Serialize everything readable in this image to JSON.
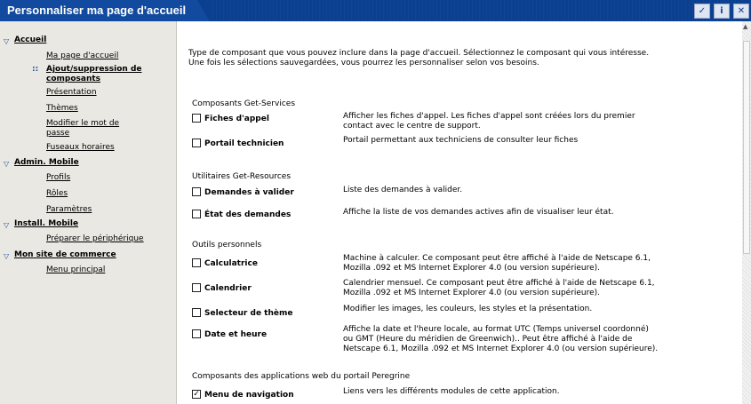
{
  "window": {
    "title": "Personnaliser ma page d'accueil",
    "icons": [
      "check-icon",
      "info-icon",
      "close-icon"
    ]
  },
  "sidebar": {
    "sections": [
      {
        "label": "Accueil",
        "items": [
          "Ma page d'accueil",
          "Ajout/suppression de composants",
          "Présentation",
          "Thèmes",
          "Modifier le mot de passe",
          "Fuseaux horaires"
        ]
      },
      {
        "label": "Admin. Mobile",
        "items": [
          "Profils",
          "Rôles",
          "Paramètres"
        ]
      },
      {
        "label": "Install. Mobile",
        "items": [
          "Préparer le périphérique"
        ]
      },
      {
        "label": "Mon site de commerce",
        "items": [
          "Menu principal"
        ]
      }
    ],
    "active_item": "Ajout/suppression de composants",
    "item_lines": {
      "add_remove_1": "Ajout/suppression de",
      "add_remove_2": "composants",
      "password_1": "Modifier le mot de",
      "password_2": "passe"
    }
  },
  "main": {
    "intro_line1": "Type de composant que vous pouvez inclure dans la page d'accueil. Sélectionnez le composant qui vous intéresse.",
    "intro_line2": "Une fois les sélections sauvegardées, vous pourrez les personnaliser selon vos besoins.",
    "groups": [
      {
        "title": "Composants Get-Services",
        "components": [
          {
            "label": "Fiches d'appel",
            "checked": false,
            "desc_lines": [
              "Afficher les fiches d'appel. Les fiches d'appel sont créées lors du premier",
              "contact avec le centre de support."
            ]
          },
          {
            "label": "Portail technicien",
            "checked": false,
            "desc_lines": [
              "Portail permettant aux techniciens de consulter leur fiches"
            ]
          }
        ]
      },
      {
        "title": "Utilitaires Get-Resources",
        "components": [
          {
            "label": "Demandes à valider",
            "checked": false,
            "desc_lines": [
              "Liste des demandes à valider."
            ]
          },
          {
            "label": "État des demandes",
            "checked": false,
            "desc_lines": [
              "Affiche la liste de vos demandes actives afin de visualiser leur état."
            ]
          }
        ]
      },
      {
        "title": "Outils personnels",
        "components": [
          {
            "label": "Calculatrice",
            "checked": false,
            "desc_lines": [
              "Machine à calculer. Ce composant peut être affiché à l'aide de Netscape 6.1,",
              "Mozilla .092 et MS Internet Explorer 4.0 (ou version supérieure)."
            ]
          },
          {
            "label": "Calendrier",
            "checked": false,
            "desc_lines": [
              "Calendrier mensuel. Ce composant peut être affiché à l'aide de Netscape 6.1,",
              "Mozilla .092 et MS Internet Explorer 4.0 (ou version supérieure)."
            ]
          },
          {
            "label": "Selecteur de thème",
            "checked": false,
            "desc_lines": [
              "Modifier les images, les couleurs, les styles et la présentation."
            ]
          },
          {
            "label": "Date et heure",
            "checked": false,
            "desc_lines": [
              "Affiche la date et l'heure locale, au format UTC (Temps universel coordonné)",
              "ou GMT (Heure du méridien de Greenwich).. Peut être affiché à l'aide de",
              "Netscape 6.1, Mozilla .092 et MS Internet Explorer 4.0 (ou version supérieure)."
            ]
          }
        ]
      },
      {
        "title": "Composants des applications web du portail Peregrine",
        "components": [
          {
            "label": "Menu de navigation",
            "checked": true,
            "desc_lines": [
              "Liens vers les différents modules de cette application."
            ]
          }
        ]
      }
    ],
    "check_mark": "✓"
  },
  "colors": {
    "titlebar": "#0b3f8f",
    "sidebar_bg": "#e9e8e2",
    "link": "#000000"
  }
}
